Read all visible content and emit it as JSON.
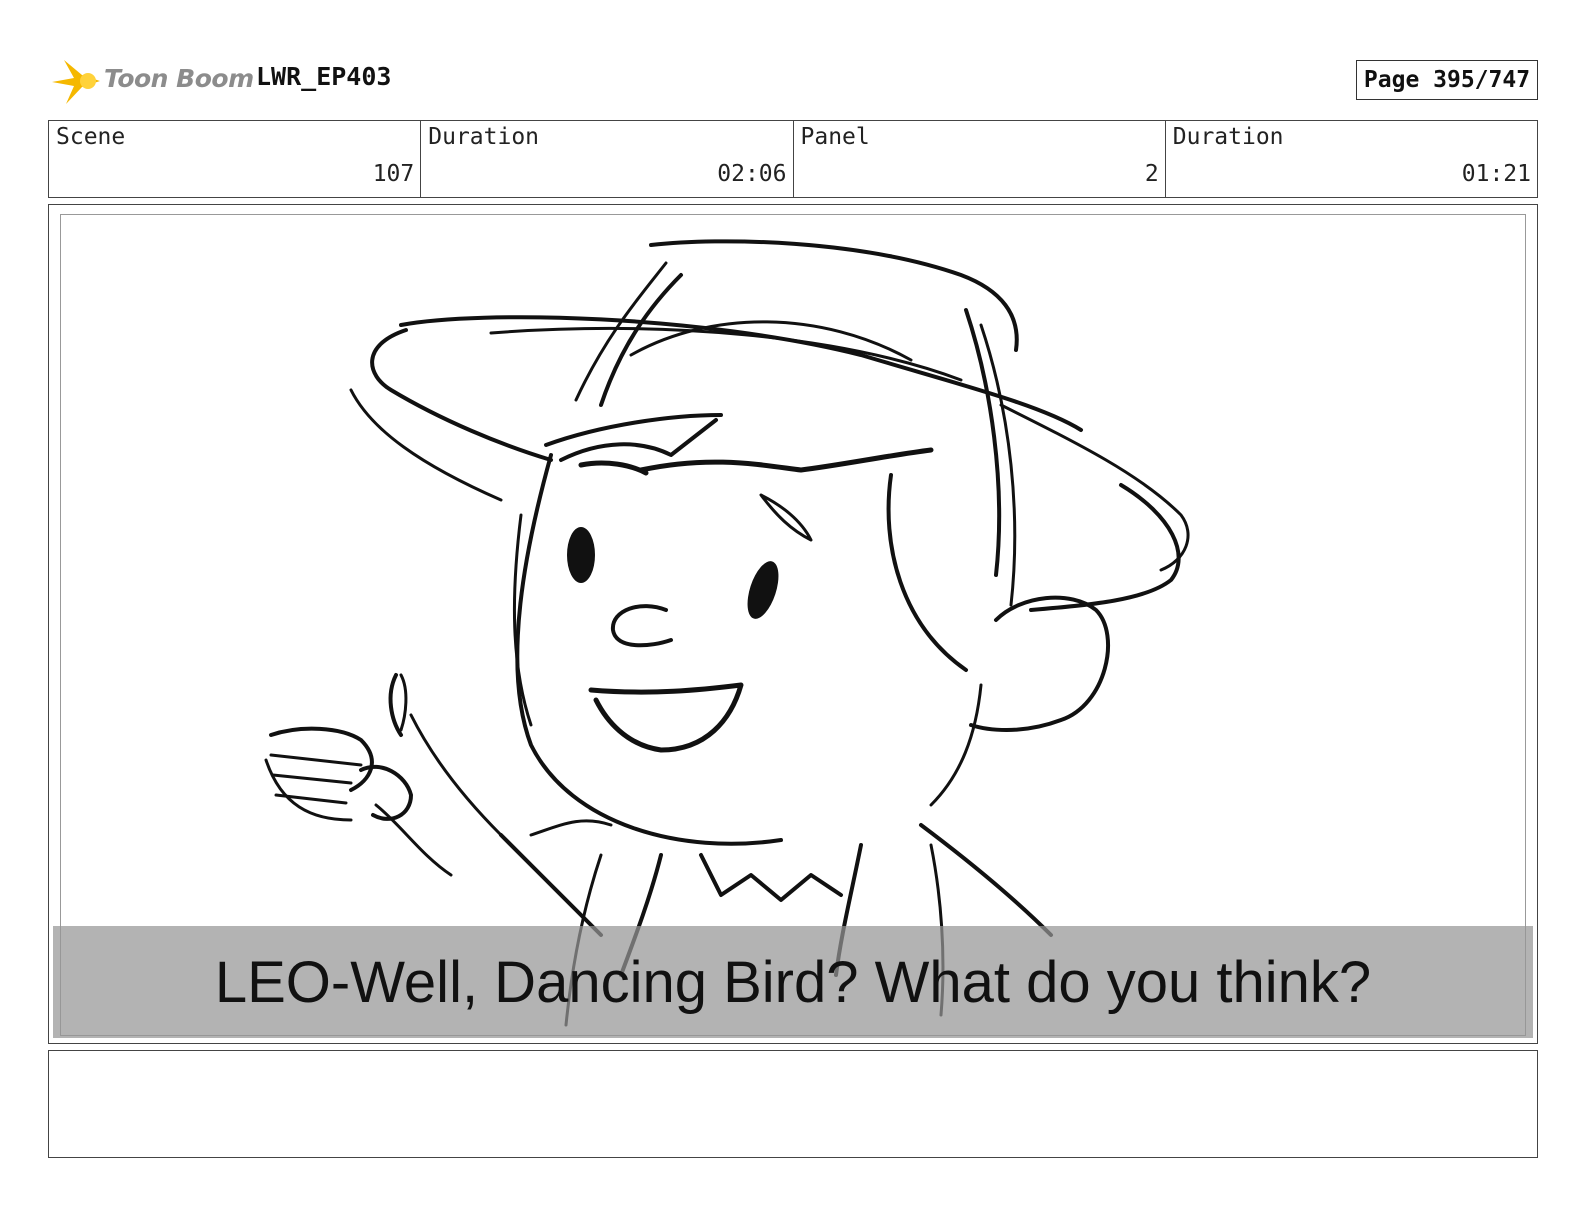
{
  "header": {
    "logo_text": "Toon Boom",
    "project": "LWR_EP403",
    "page": "Page 395/747"
  },
  "info": {
    "scene_label": "Scene",
    "scene_value": "107",
    "scene_duration_label": "Duration",
    "scene_duration_value": "02:06",
    "panel_label": "Panel",
    "panel_value": "2",
    "panel_duration_label": "Duration",
    "panel_duration_value": "01:21"
  },
  "panel": {
    "caption": "LEO-Well, Dancing Bird? What do you think?"
  },
  "notes": {
    "text": ""
  },
  "icons": {
    "logo": "toon-boom-star-logo-icon"
  }
}
